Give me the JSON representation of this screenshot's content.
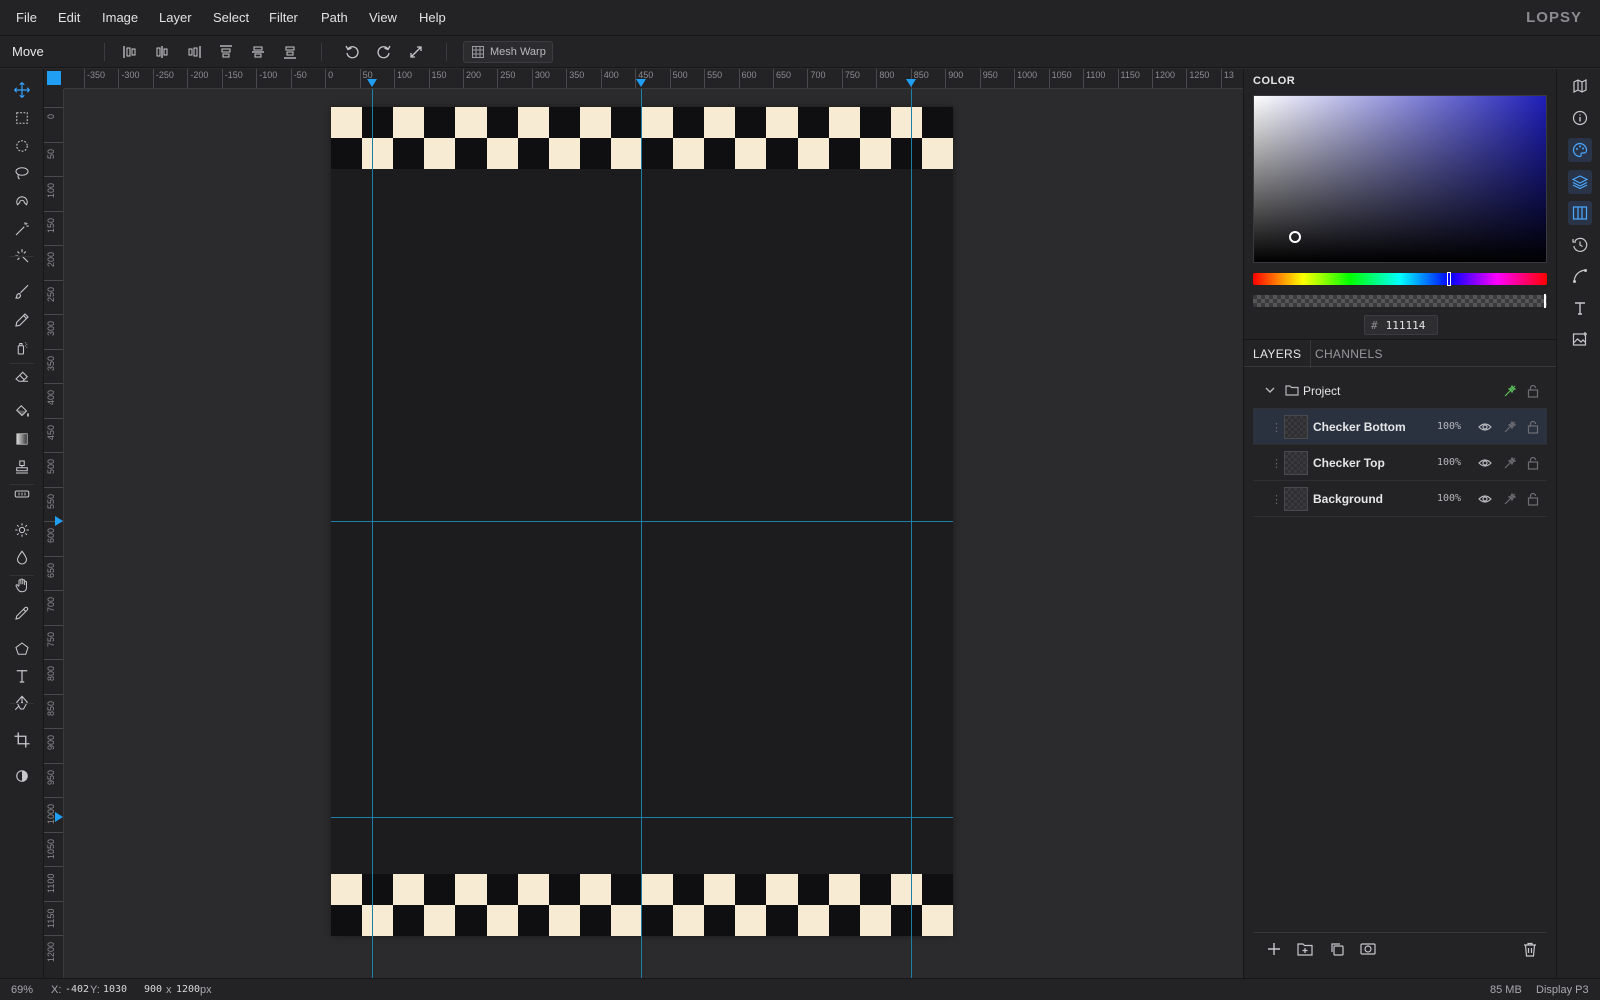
{
  "app": {
    "logo": "LOPSY"
  },
  "menu": {
    "items": [
      "File",
      "Edit",
      "Image",
      "Layer",
      "Select",
      "Filter",
      "Path",
      "View",
      "Help"
    ]
  },
  "options": {
    "tool_name": "Move",
    "align_buttons": [
      "align-left-icon",
      "align-center-h-icon",
      "align-right-icon",
      "align-top-icon",
      "align-middle-v-icon",
      "align-bottom-icon"
    ],
    "transform_buttons": [
      "rotate-ccw-icon",
      "rotate-cw-icon",
      "expand-icon"
    ],
    "mesh_warp_label": "Mesh Warp"
  },
  "tools": [
    "move-icon",
    "rect-marquee-icon",
    "ellipse-marquee-icon",
    "lasso-icon",
    "magnetic-lasso-icon",
    "magic-wand-icon",
    "quick-select-icon",
    "brush-icon",
    "pencil-icon",
    "spray-icon",
    "eraser-icon",
    "paint-bucket-icon",
    "gradient-icon",
    "stamp-icon",
    "healing-icon",
    "dodge-icon",
    "blur-icon",
    "hand-icon",
    "eyedropper-icon",
    "polygon-icon",
    "text-icon",
    "pen-icon",
    "crop-icon",
    "contrast-icon"
  ],
  "ruler": {
    "h_labels": [
      "-350",
      "-300",
      "-250",
      "-200",
      "-150",
      "-100",
      "-50",
      "0",
      "50",
      "100",
      "150",
      "200",
      "250",
      "300",
      "350",
      "400",
      "450",
      "500",
      "550",
      "600",
      "650",
      "700",
      "750",
      "800",
      "850",
      "900",
      "950",
      "1000",
      "1050",
      "1100",
      "1150",
      "1200",
      "1250",
      "13"
    ],
    "v_labels": [
      "0",
      "50",
      "100",
      "150",
      "200",
      "250",
      "300",
      "350",
      "400",
      "450",
      "500",
      "550",
      "600",
      "650",
      "700",
      "750",
      "800",
      "850",
      "900",
      "950",
      "1000",
      "1050",
      "1100",
      "1150",
      "1200"
    ]
  },
  "canvas": {
    "checker_light": "#f7ebd3",
    "checker_dark": "#0f0f11",
    "guide_color": "#1d7fa8"
  },
  "color_panel": {
    "title": "COLOR",
    "hex_value": "111114",
    "hash": "#"
  },
  "tabs": {
    "layers": "LAYERS",
    "channels": "CHANNELS"
  },
  "layers": {
    "group": {
      "name": "Project"
    },
    "items": [
      {
        "name": "Checker Bottom",
        "opacity": "100%",
        "selected": true
      },
      {
        "name": "Checker Top",
        "opacity": "100%",
        "selected": false
      },
      {
        "name": "Background",
        "opacity": "100%",
        "selected": false
      }
    ]
  },
  "panel_actions": [
    "add-layer-icon",
    "add-group-icon",
    "duplicate-icon",
    "mask-icon",
    "trash-icon"
  ],
  "side_icons": [
    "map-icon",
    "info-icon",
    "palette-icon",
    "layers-icon",
    "columns-icon",
    "history-icon",
    "curve-icon",
    "text-icon",
    "image-icon"
  ],
  "status": {
    "zoom": "69%",
    "x_label": "X:",
    "x_value": "-402",
    "y_label": "Y:",
    "y_value": "1030",
    "doc_width": "900",
    "doc_x": "x",
    "doc_height": "1200",
    "doc_unit": "px",
    "memory": "85 MB",
    "color_profile": "Display P3"
  }
}
